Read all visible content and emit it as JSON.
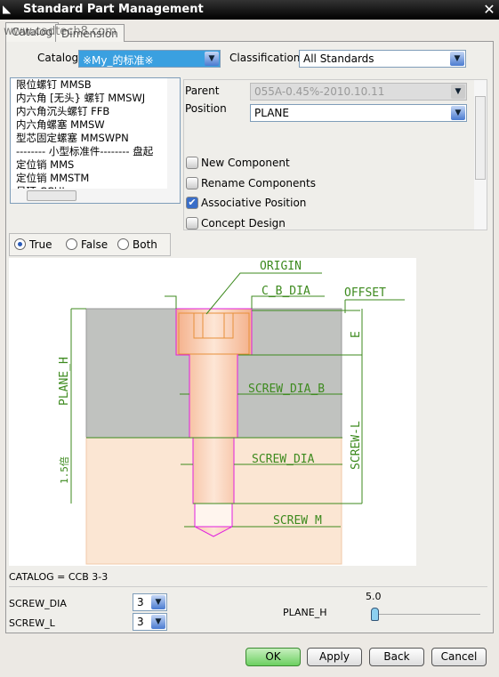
{
  "window": {
    "title": "Standard Part Management",
    "watermark": "www.cadtech8.com"
  },
  "tabs": [
    {
      "label": "Catalog"
    },
    {
      "label": "Dimension"
    }
  ],
  "catalog": {
    "label": "Catalog",
    "value": "※My_的标准※"
  },
  "classification": {
    "label": "Classification",
    "value": "All Standards"
  },
  "parts_list": [
    "限位螺钉  MMSB",
    "内六角 [无头} 螺钉  MMSWJ",
    "内六角沉头螺钉  FFB",
    "内六角螺塞  MMSW",
    "型芯固定螺塞  MMSWPN",
    "-------- 小型标准件--------  盘起",
    "定位销  MMS",
    "定位销  MMSTM",
    "吊环 CCHI"
  ],
  "parent": {
    "label": "Parent",
    "value": "055A-0.45%-2010.10.11"
  },
  "position": {
    "label": "Position",
    "value": "PLANE"
  },
  "options": [
    {
      "label": "New Component",
      "checked": false
    },
    {
      "label": "Rename Components",
      "checked": false
    },
    {
      "label": "Associative Position",
      "checked": true
    },
    {
      "label": "Concept Design",
      "checked": false
    }
  ],
  "radios": [
    {
      "label": "True",
      "selected": true
    },
    {
      "label": "False",
      "selected": false
    },
    {
      "label": "Both",
      "selected": false
    }
  ],
  "diagram": {
    "origin": "ORIGIN",
    "cb_dia": "C_B_DIA",
    "offset": "OFFSET",
    "e": "E",
    "plane_h": "PLANE_H",
    "screw_dia_b": "SCREW_DIA_B",
    "screw_l": "SCREW-L",
    "screw_dia": "SCREW_DIA",
    "ratio": "1.5倍",
    "screw_m": "SCREW_M"
  },
  "catalog_info": "CATALOG = CCB 3-3",
  "params": {
    "screw_dia": {
      "label": "SCREW_DIA",
      "value": "3"
    },
    "screw_l": {
      "label": "SCREW_L",
      "value": "3"
    },
    "plane_h": {
      "label": "PLANE_H",
      "value": "5.0",
      "slider_fraction": 0.0
    }
  },
  "buttons": {
    "ok": "OK",
    "apply": "Apply",
    "back": "Back",
    "cancel": "Cancel"
  },
  "colors": {
    "dim_line": "#3d8a1e",
    "screw_outline": "#e020e0",
    "plate_gray": "#c0c2bf",
    "plate_beige": "#fbe6d3"
  }
}
